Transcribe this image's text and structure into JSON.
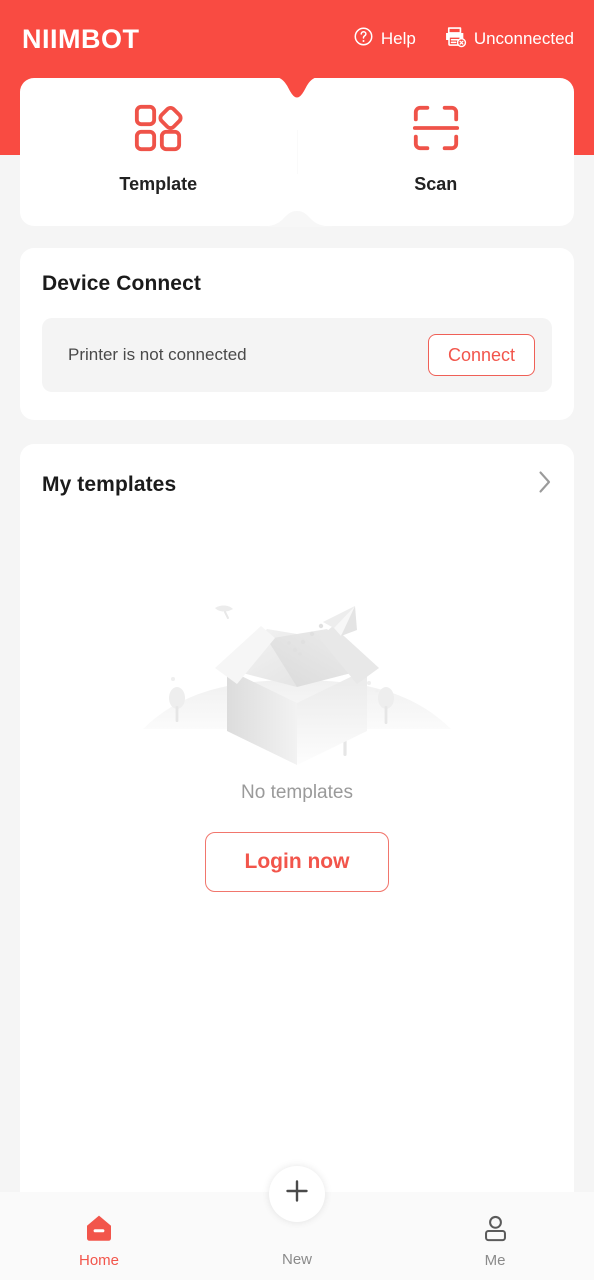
{
  "header": {
    "brand": "NIIMBOT",
    "help_label": "Help",
    "help_icon": "question-circle-icon",
    "connection_label": "Unconnected",
    "connection_icon": "printer-disconnected-icon",
    "background_color": "#f94b42"
  },
  "actions": [
    {
      "label": "Template",
      "icon": "template-grid-icon"
    },
    {
      "label": "Scan",
      "icon": "scan-frame-icon"
    }
  ],
  "device_connect": {
    "title": "Device Connect",
    "status_text": "Printer is not connected",
    "connect_label": "Connect",
    "accent_color": "#f2554b"
  },
  "my_templates": {
    "title": "My templates",
    "chevron_icon": "chevron-right-icon",
    "empty_illustration": "empty-box-paper-plane-illustration",
    "empty_text": "No templates",
    "login_label": "Login now"
  },
  "bottom_nav": {
    "items": [
      {
        "label": "Home",
        "icon": "home-icon",
        "active": true
      },
      {
        "label": "New",
        "icon": "plus-icon",
        "active": false
      },
      {
        "label": "Me",
        "icon": "person-icon",
        "active": false
      }
    ],
    "active_color": "#f2554b",
    "inactive_color": "#8a8a8a"
  }
}
